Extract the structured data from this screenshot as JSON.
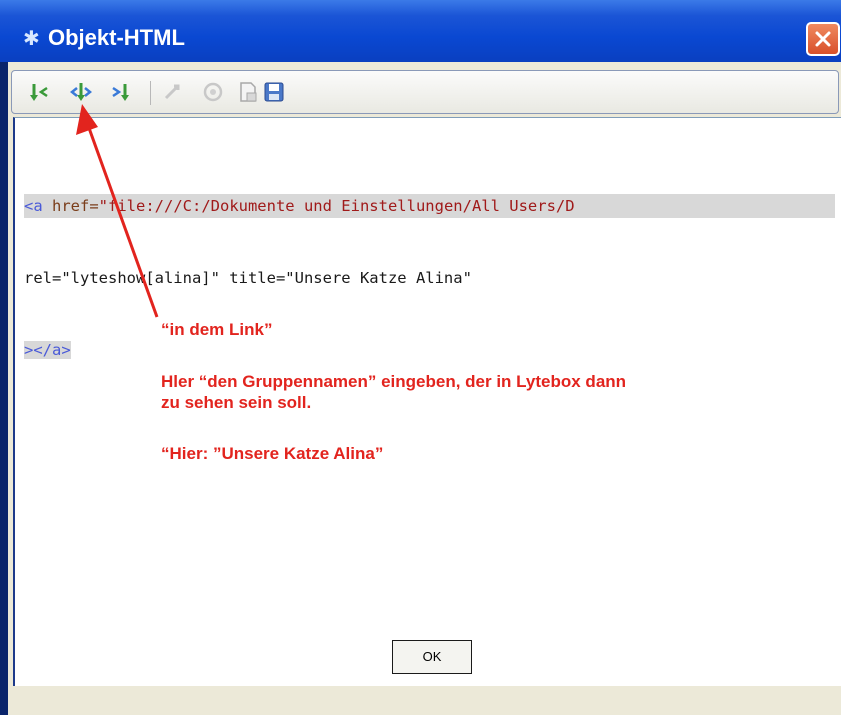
{
  "window": {
    "title": "Objekt-HTML"
  },
  "toolbar": {
    "buttons": [
      {
        "icon": "insert-start-icon"
      },
      {
        "icon": "insert-both-icon"
      },
      {
        "icon": "insert-end-icon"
      },
      {
        "icon": "remove-icon"
      },
      {
        "icon": "preview-icon"
      },
      {
        "icon": "open-file-icon"
      },
      {
        "icon": "save-icon"
      }
    ]
  },
  "editor": {
    "line1": {
      "tag": "<a",
      "attr": " href=",
      "value": "\"file:///C:/Dokumente und Einstellungen/All Users/D"
    },
    "line2": {
      "attr": "rel=",
      "value1": "\"lyteshow[alina]\"",
      "title_attr": " title=",
      "value2": "\"Unsere Katze Alina\""
    },
    "line3": {
      "tag": "></a>"
    }
  },
  "annotation": {
    "line1": "“in dem Link”",
    "line2": "Hler “den Gruppennamen” eingeben, der in Lytebox dann",
    "line3": "zu sehen sein soll.",
    "line4": "“Hier: ”Unsere Katze Alina”"
  },
  "footer": {
    "ok_label": "OK"
  },
  "colors": {
    "annotation": "#e2241e",
    "titlebar": "#0a48d2",
    "tag": "#4a5ad8",
    "string": "#a01a1a"
  }
}
